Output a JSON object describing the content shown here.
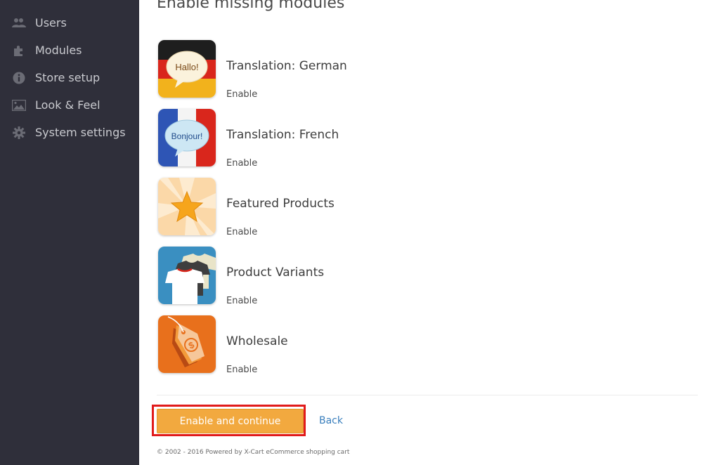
{
  "sidebar": {
    "items": [
      {
        "label": "Users",
        "icon": "users-icon"
      },
      {
        "label": "Modules",
        "icon": "puzzle-icon"
      },
      {
        "label": "Store setup",
        "icon": "info-icon"
      },
      {
        "label": "Look & Feel",
        "icon": "image-icon"
      },
      {
        "label": "System settings",
        "icon": "gear-icon"
      }
    ]
  },
  "main": {
    "title": "Enable missing modules",
    "modules": [
      {
        "name": "Translation: German",
        "enable_label": "Enable",
        "icon": "german-flag-speech-icon",
        "icon_text": "Hallo!"
      },
      {
        "name": "Translation: French",
        "enable_label": "Enable",
        "icon": "french-flag-speech-icon",
        "icon_text": "Bonjour!"
      },
      {
        "name": "Featured Products",
        "enable_label": "Enable",
        "icon": "star-icon"
      },
      {
        "name": "Product Variants",
        "enable_label": "Enable",
        "icon": "tshirts-icon"
      },
      {
        "name": "Wholesale",
        "enable_label": "Enable",
        "icon": "price-tags-icon"
      }
    ],
    "actions": {
      "primary_label": "Enable and continue",
      "back_label": "Back"
    },
    "footer": "© 2002 - 2016 Powered by X-Cart eCommerce shopping cart"
  },
  "colors": {
    "sidebar_bg": "#2f2f3a",
    "primary_button": "#f2a93f",
    "highlight": "#e11b1b",
    "link": "#3a7fbd"
  }
}
